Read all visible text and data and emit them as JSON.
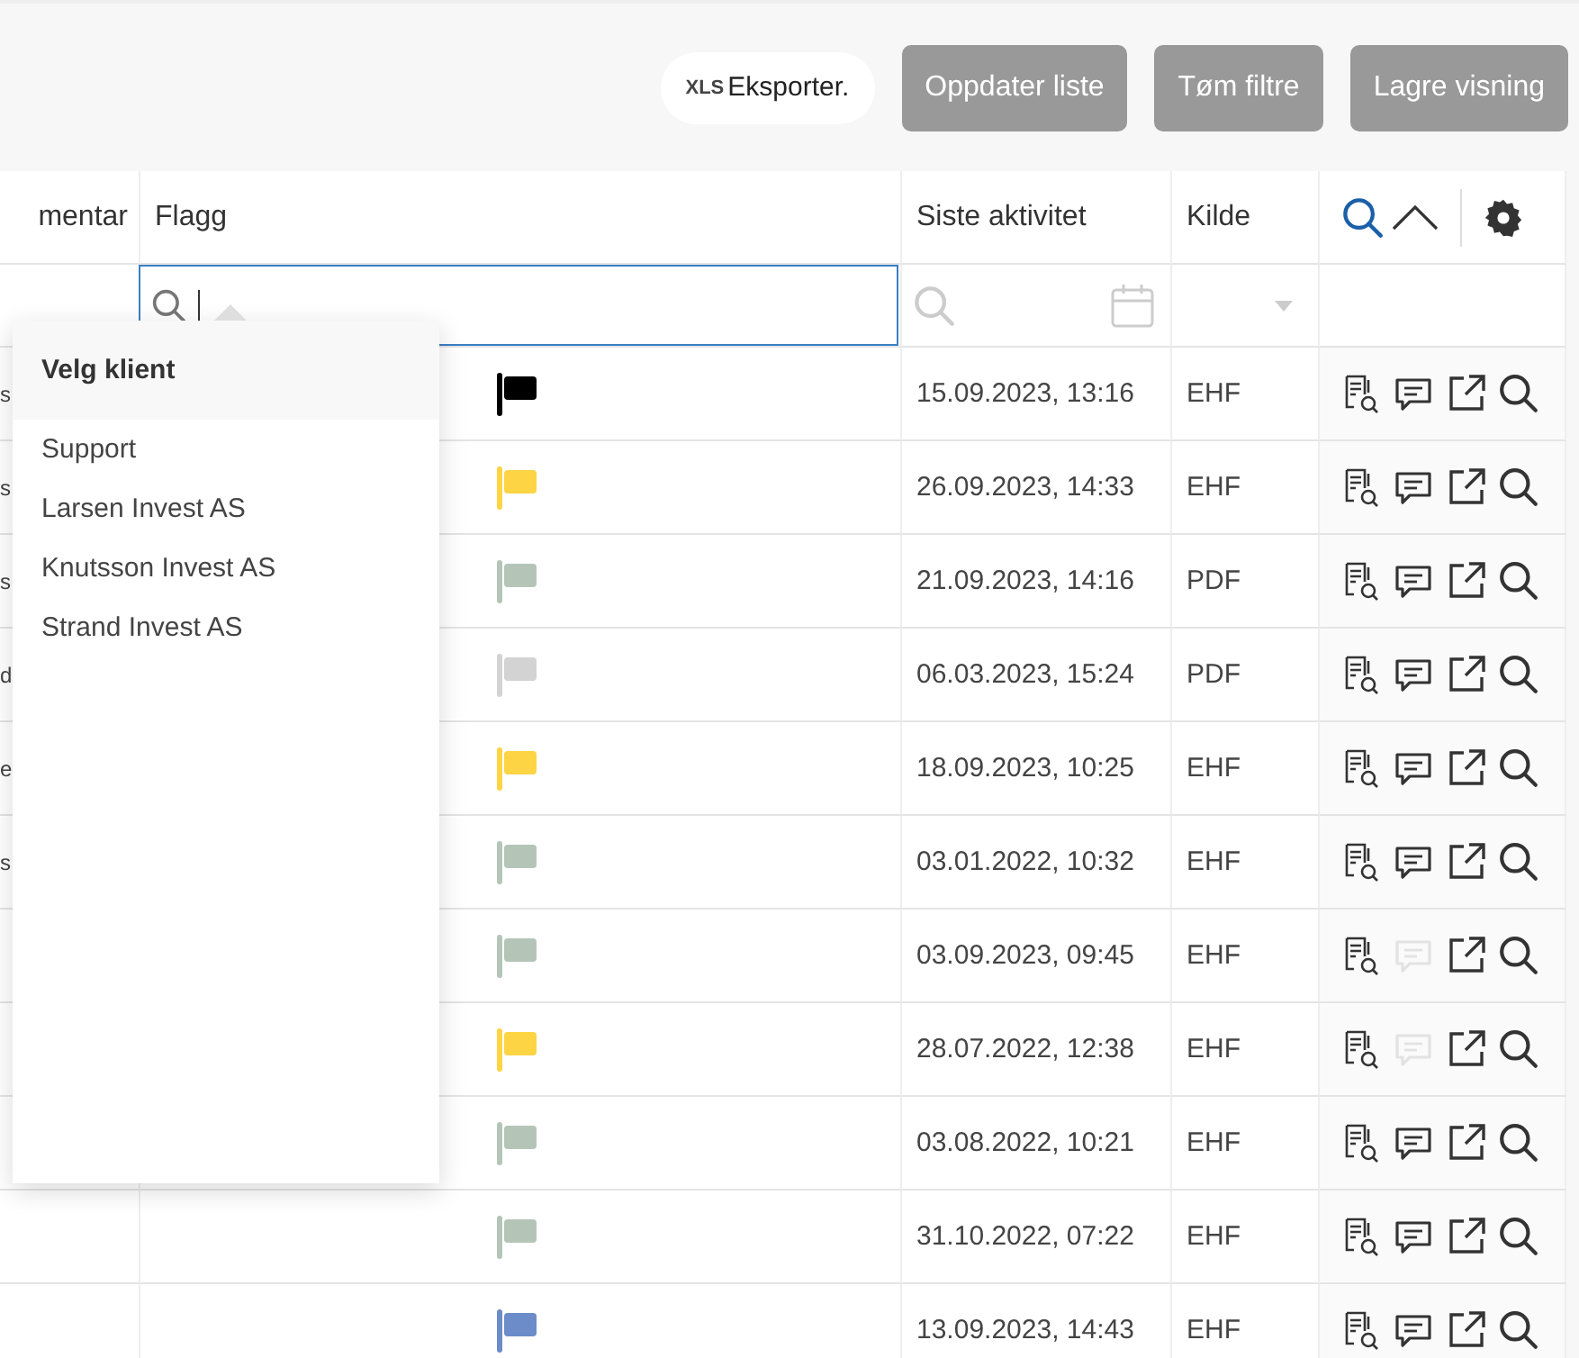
{
  "toolbar": {
    "export": {
      "badge": "XLS",
      "label": "Eksporter."
    },
    "buttons": [
      "Oppdater liste",
      "Tøm filtre",
      "Lagre visning"
    ]
  },
  "table": {
    "columns": [
      {
        "label": "mentar"
      },
      {
        "label": "Flagg"
      },
      {
        "label": "Siste aktivitet"
      },
      {
        "label": "Kilde"
      }
    ],
    "flag_filter": {
      "focused": true
    },
    "rows": [
      {
        "column_1": "s",
        "flag": {
          "color": "#000000"
        },
        "activity": "15.09.2023, 13:16",
        "source": "EHF",
        "has_comment": true
      },
      {
        "column_1": "s",
        "flag": {
          "color": "#fdd443"
        },
        "activity": "26.09.2023, 14:33",
        "source": "EHF",
        "has_comment": true
      },
      {
        "column_1": "s",
        "flag": {
          "color": "#b4c5b7"
        },
        "activity": "21.09.2023, 14:16",
        "source": "PDF",
        "has_comment": true
      },
      {
        "column_1": "d",
        "flag": {
          "color": "#d3d3d3"
        },
        "activity": "06.03.2023, 15:24",
        "source": "PDF",
        "has_comment": true
      },
      {
        "column_1": "e",
        "flag": {
          "color": "#fdd443"
        },
        "activity": "18.09.2023, 10:25",
        "source": "EHF",
        "has_comment": true
      },
      {
        "column_1": "s",
        "flag": {
          "color": "#b4c5b7"
        },
        "activity": "03.01.2022, 10:32",
        "source": "EHF",
        "has_comment": true
      },
      {
        "flag": {
          "color": "#b4c5b7"
        },
        "activity": "03.09.2023, 09:45",
        "source": "EHF",
        "has_comment": false
      },
      {
        "flag": {
          "color": "#fdd443"
        },
        "activity": "28.07.2022, 12:38",
        "source": "EHF",
        "has_comment": false
      },
      {
        "flag": {
          "color": "#b4c5b7"
        },
        "activity": "03.08.2022, 10:21",
        "source": "EHF",
        "has_comment": true
      },
      {
        "flag": {
          "color": "#b4c5b7"
        },
        "activity": "31.10.2022, 07:22",
        "source": "EHF",
        "has_comment": true
      },
      {
        "flag": {
          "color": "#6b8cc8"
        },
        "activity": "13.09.2023, 14:43",
        "source": "EHF",
        "has_comment": true
      }
    ]
  },
  "client_menu": {
    "title": "Velg klient",
    "items": [
      "Support",
      "Larsen Invest AS",
      "Knutsson Invest AS",
      "Strand Invest AS"
    ]
  }
}
